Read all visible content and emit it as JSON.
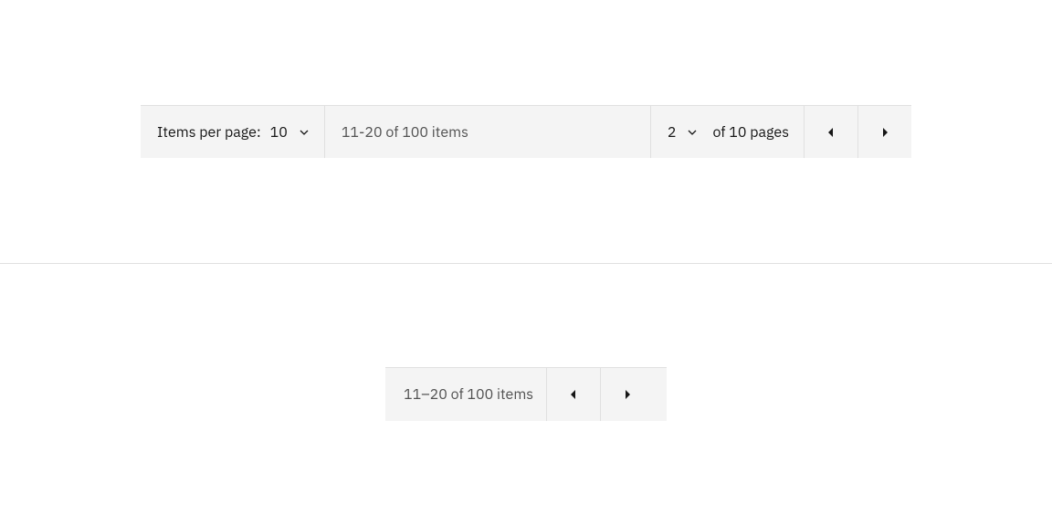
{
  "topPagination": {
    "itemsPerPageLabel": "Items per page:",
    "itemsPerPageValue": "10",
    "rangeText": "11-20 of 100 items",
    "currentPage": "2",
    "ofPagesText": "of 10 pages"
  },
  "bottomPagination": {
    "rangeText": "11–20 of 100 items"
  }
}
